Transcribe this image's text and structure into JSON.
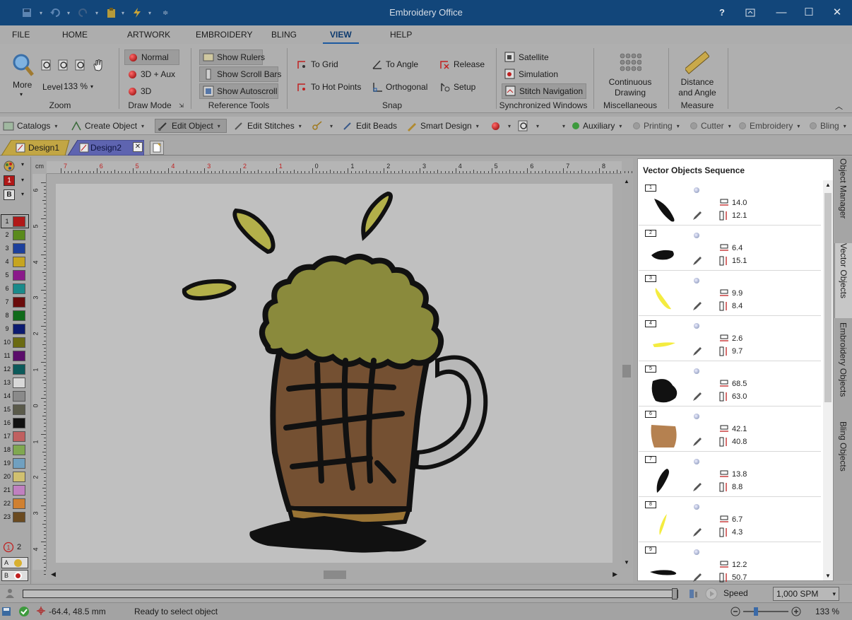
{
  "app": {
    "title": "Embroidery Office"
  },
  "menu": {
    "tabs": [
      "FILE",
      "HOME",
      "ARTWORK",
      "EMBROIDERY",
      "BLING",
      "VIEW",
      "HELP"
    ],
    "active": "VIEW"
  },
  "ribbon": {
    "zoom": {
      "label": "Zoom",
      "more": "More",
      "level_label": "Level",
      "level_value": "133 %"
    },
    "draw_mode": {
      "label": "Draw Mode",
      "normal": "Normal",
      "aux": "3D + Aux",
      "three_d": "3D"
    },
    "reference_tools": {
      "label": "Reference Tools",
      "rulers": "Show Rulers",
      "scrollbars": "Show Scroll Bars",
      "autoscroll": "Show Autoscroll"
    },
    "snap": {
      "label": "Snap",
      "to_grid": "To Grid",
      "to_hot_points": "To Hot Points",
      "to_angle": "To Angle",
      "orthogonal": "Orthogonal",
      "release": "Release",
      "setup": "Setup"
    },
    "sync_windows": {
      "label": "Synchronized Windows",
      "satellite": "Satellite",
      "simulation": "Simulation",
      "stitch_navigation": "Stitch Navigation"
    },
    "misc": {
      "label": "Miscellaneous",
      "continuous_1": "Continuous",
      "continuous_2": "Drawing"
    },
    "measure": {
      "label": "Measure",
      "distance_1": "Distance",
      "distance_2": "and Angle"
    }
  },
  "toolbar": {
    "catalogs": "Catalogs",
    "create_object": "Create Object",
    "edit_object": "Edit Object",
    "edit_stitches": "Edit Stitches",
    "edit_beads": "Edit Beads",
    "smart_design": "Smart Design",
    "auxiliary": "Auxiliary",
    "printing": "Printing",
    "cutter": "Cutter",
    "embroidery": "Embroidery",
    "bling": "Bling"
  },
  "doc_tabs": [
    "Design1",
    "Design2"
  ],
  "palette": {
    "top_a": "1",
    "top_b": "B",
    "colors": [
      "#b01818",
      "#5a8a1c",
      "#1c3f9c",
      "#c6a520",
      "#8a1a8a",
      "#1a8a8a",
      "#6a0c0c",
      "#0f6a1a",
      "#0c1a70",
      "#6a6a12",
      "#5a0c6a",
      "#0c5a5a",
      "#d8d8d8",
      "#8a8a8a",
      "#5a5a4a",
      "#111111",
      "#c06060",
      "#80a850",
      "#70a0c0",
      "#d0c070",
      "#c080c0",
      "#d08030",
      "#6a4a20"
    ],
    "footer_count": "2"
  },
  "ruler": {
    "unit": "cm",
    "h_labels": [
      "7",
      "6",
      "5",
      "4",
      "3",
      "2",
      "1",
      "0",
      "1",
      "2",
      "3",
      "4",
      "5",
      "6",
      "7",
      "8"
    ],
    "v_labels": [
      "6",
      "5",
      "4",
      "3",
      "2",
      "1",
      "0",
      "1",
      "2",
      "3",
      "4"
    ]
  },
  "panel": {
    "title": "Vector Objects Sequence",
    "objects": [
      {
        "n": "1",
        "w": "14.0",
        "h": "12.1",
        "color": "#111"
      },
      {
        "n": "2",
        "w": "6.4",
        "h": "15.1",
        "color": "#111"
      },
      {
        "n": "3",
        "w": "9.9",
        "h": "8.4",
        "color": "#f4ec40"
      },
      {
        "n": "4",
        "w": "2.6",
        "h": "9.7",
        "color": "#f4ec40"
      },
      {
        "n": "5",
        "w": "68.5",
        "h": "63.0",
        "color": "#111"
      },
      {
        "n": "6",
        "w": "42.1",
        "h": "40.8",
        "color": "#b58150"
      },
      {
        "n": "7",
        "w": "13.8",
        "h": "8.8",
        "color": "#111"
      },
      {
        "n": "8",
        "w": "6.7",
        "h": "4.3",
        "color": "#f4ec40"
      },
      {
        "n": "9",
        "w": "12.2",
        "h": "50.7",
        "color": "#111"
      }
    ]
  },
  "side_tabs": [
    "Object Manager",
    "Vector Objects",
    "Embroidery Objects",
    "Bling Objects"
  ],
  "speed": {
    "label": "Speed",
    "value": "1,000 SPM"
  },
  "status": {
    "coords": "-64.4, 48.5 mm",
    "message": "Ready to select object",
    "zoom": "133 %"
  }
}
